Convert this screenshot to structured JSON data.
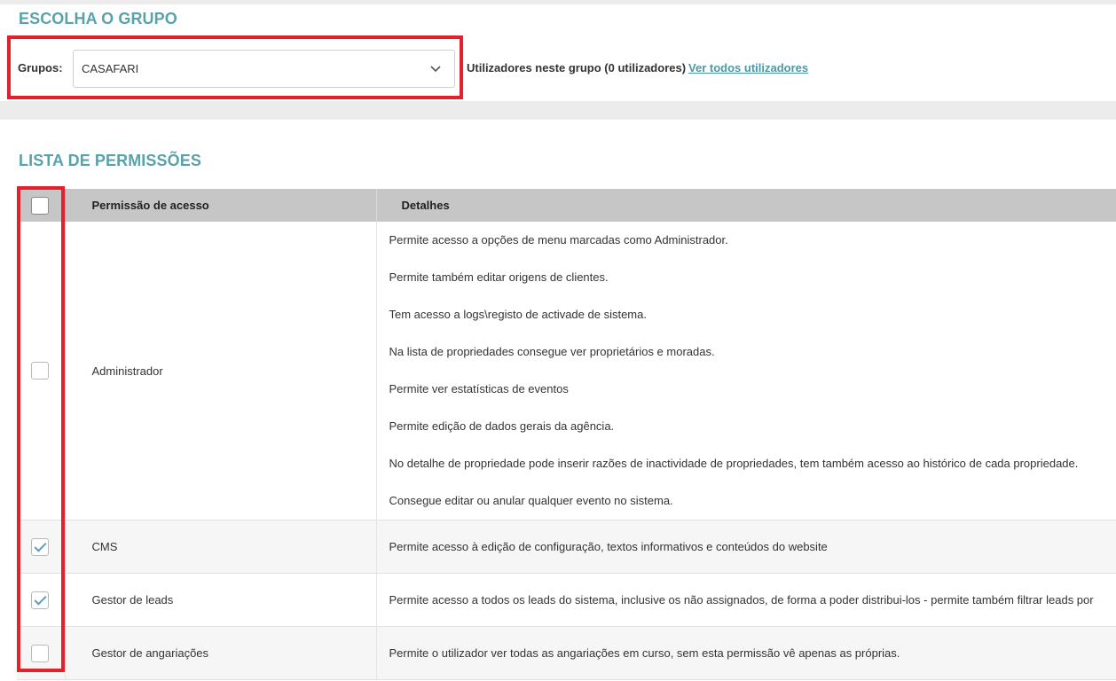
{
  "group_section": {
    "title": "ESCOLHA O GRUPO",
    "label": "Grupos:",
    "selected": "CASAFARI",
    "users_info": "Utilizadores neste grupo (0 utilizadores)",
    "view_all_link": "Ver todos utilizadores"
  },
  "permissions_section": {
    "title": "LISTA DE PERMISSÕES",
    "columns": [
      "Permissão de acesso",
      "Detalhes"
    ],
    "rows": [
      {
        "name": "Administrador",
        "checked": false,
        "details": [
          "Permite acesso a opções de menu marcadas como Administrador.",
          "Permite também editar origens de clientes.",
          "Tem acesso a logs\\registo de activade de sistema.",
          "Na lista de propriedades consegue ver proprietários e moradas.",
          "Permite ver estatísticas de eventos",
          "Permite edição de dados gerais da agência.",
          "No detalhe de propriedade pode inserir razões de inactividade de propriedades, tem também acesso ao histórico de cada propriedade.",
          "Consegue editar ou anular qualquer evento no sistema."
        ]
      },
      {
        "name": "CMS",
        "checked": true,
        "details": [
          "Permite acesso à edição de configuração, textos informativos e conteúdos do website"
        ]
      },
      {
        "name": "Gestor de leads",
        "checked": true,
        "details": [
          "Permite acesso a todos os leads do sistema, inclusive os não assignados, de forma a poder distribui-los - permite também filtrar leads por"
        ]
      },
      {
        "name": "Gestor de angariações",
        "checked": false,
        "details": [
          "Permite o utilizador ver todas as angariações em curso, sem esta permissão vê apenas as próprias."
        ]
      }
    ]
  },
  "colors": {
    "accent": "#5aa2aa",
    "highlight": "#e3212d",
    "check": "#5aa0c4"
  }
}
